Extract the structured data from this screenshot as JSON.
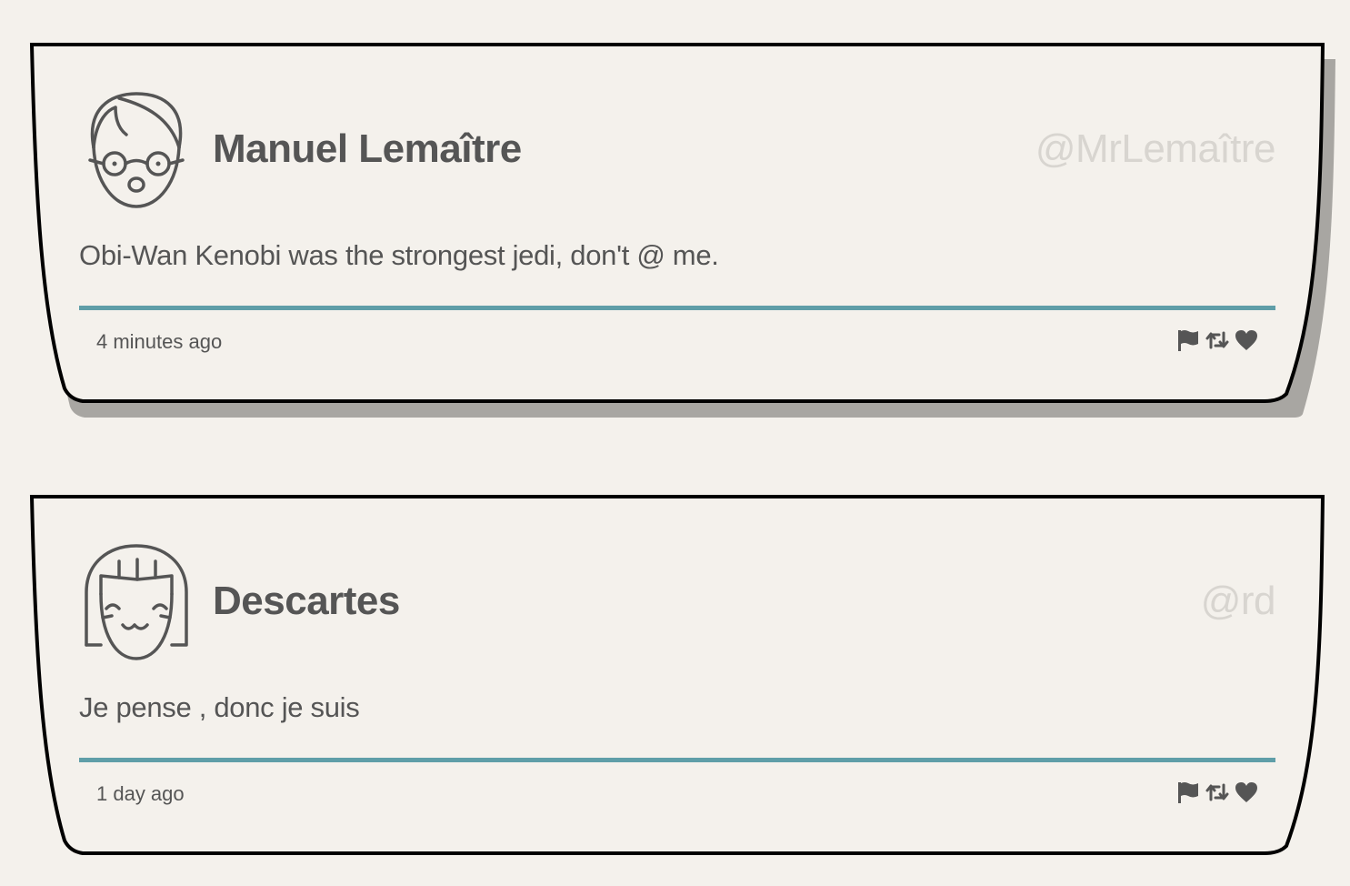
{
  "tweets": [
    {
      "name": "Manuel Lemaître",
      "handle": "@MrLemaître",
      "message": "Obi-Wan Kenobi was the strongest jedi, don't @ me.",
      "time": "4 minutes ago",
      "avatar_icon": "boy-with-glasses-avatar-icon"
    },
    {
      "name": "Descartes",
      "handle": "@rd",
      "message": "Je pense , donc je suis",
      "time": "1 day ago",
      "avatar_icon": "girl-smiling-avatar-icon"
    }
  ],
  "actions": [
    "flag-icon",
    "retweet-icon",
    "heart-icon"
  ],
  "colors": {
    "background": "#f4f1ec",
    "divider": "#5f9ea8",
    "text": "#555555",
    "handle": "#d8d5d0",
    "border": "#000000",
    "shadow": "#a8a6a2"
  }
}
